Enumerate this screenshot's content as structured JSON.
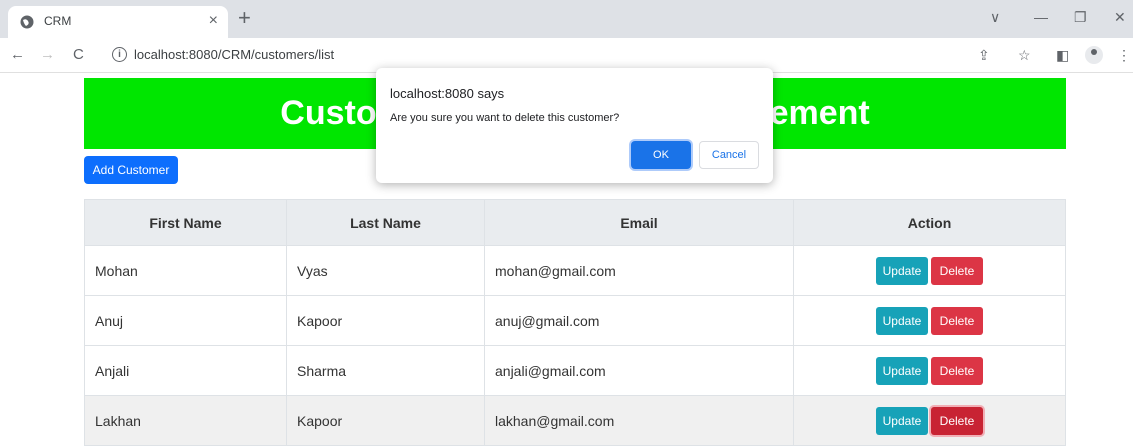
{
  "browser": {
    "tab_title": "CRM",
    "tab_close": "×",
    "new_tab": "+",
    "url": "localhost:8080/CRM/customers/list",
    "back": "←",
    "forward": "→",
    "reload": "C",
    "info": "i",
    "share": "⇪",
    "bookmark": "☆",
    "sidepanel": "◧",
    "menu": "⋮",
    "dropdown": "∨",
    "minimize": "—",
    "restore": "❐",
    "close": "✕"
  },
  "page": {
    "title": "Customer Relationship Management",
    "add_button": "Add Customer",
    "table": {
      "headers": [
        "First Name",
        "Last Name",
        "Email",
        "Action"
      ],
      "rows": [
        {
          "first": "Mohan",
          "last": "Vyas",
          "email": "mohan@gmail.com"
        },
        {
          "first": "Anuj",
          "last": "Kapoor",
          "email": "anuj@gmail.com"
        },
        {
          "first": "Anjali",
          "last": "Sharma",
          "email": "anjali@gmail.com"
        },
        {
          "first": "Lakhan",
          "last": "Kapoor",
          "email": "lakhan@gmail.com"
        }
      ],
      "update_label": "Update",
      "delete_label": "Delete"
    }
  },
  "dialog": {
    "title": "localhost:8080 says",
    "message": "Are you sure you want to delete this customer?",
    "ok": "OK",
    "cancel": "Cancel"
  },
  "colors": {
    "banner": "#00e600",
    "primary": "#0d6efd",
    "info": "#17a2b8",
    "danger": "#dc3545"
  }
}
